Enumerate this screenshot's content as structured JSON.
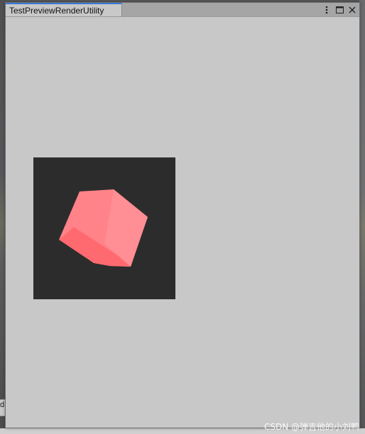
{
  "window": {
    "tab_title": "TestPreviewRenderUtility"
  },
  "controls": {
    "menu_icon": "kebab-menu-icon",
    "maximize_icon": "maximize-icon",
    "close_icon": "close-icon"
  },
  "preview": {
    "background_color": "#2c2c2c",
    "object": "cube",
    "cube_colors": {
      "top": "#ff8389",
      "right": "#ff8f94",
      "front": "#ff6a70"
    }
  },
  "background_editor": {
    "left_edge_glyph": "d"
  },
  "watermark": {
    "text": "CSDN @弹吉他的小刘鸭"
  }
}
